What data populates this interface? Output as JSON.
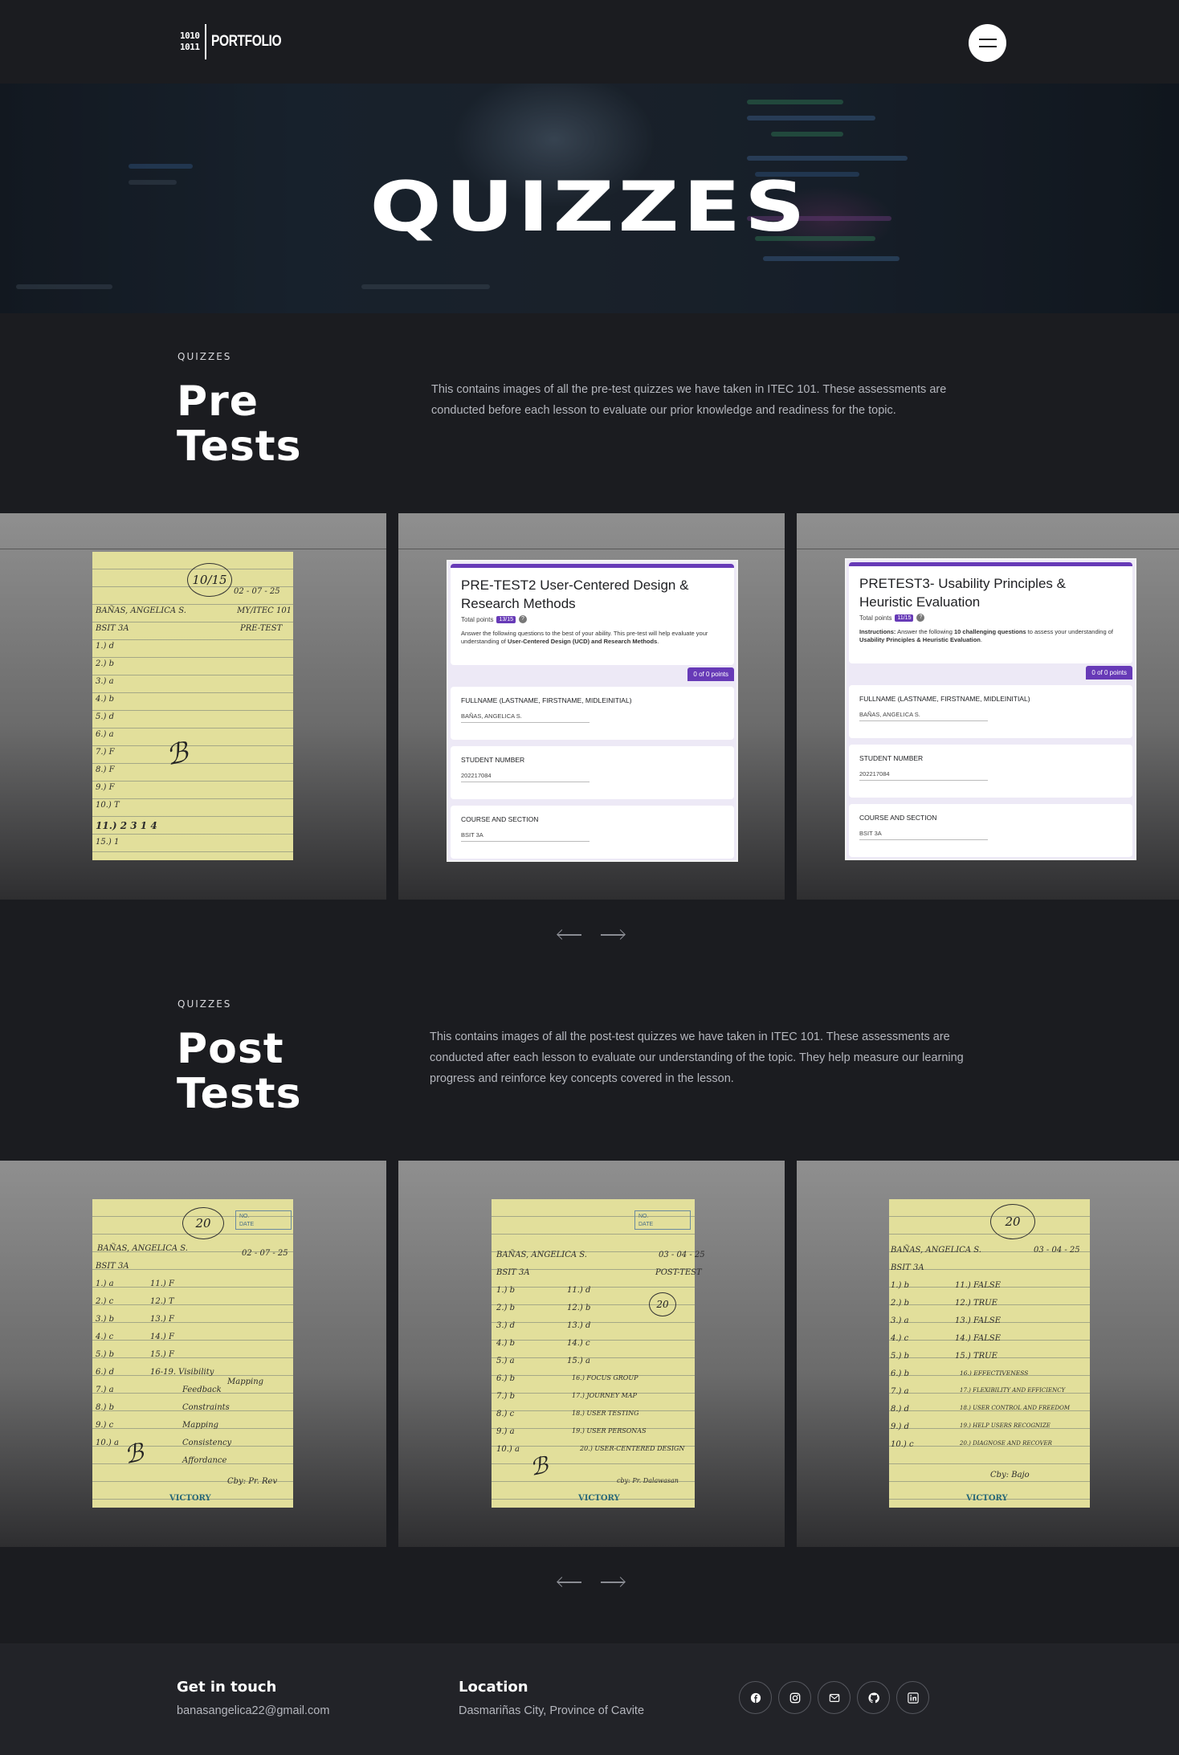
{
  "header": {
    "logo_bits_1": "1010",
    "logo_bits_2": "1011",
    "logo_word": "PORTFOLIO",
    "menu_icon": "hamburger-icon"
  },
  "hero": {
    "title": "QUIZZES"
  },
  "pretests": {
    "eyebrow": "QUIZZES",
    "title_line1": "Pre",
    "title_line2": "Tests",
    "description": "This contains images of all the pre-test quizzes we have taken in ITEC 101. These assessments are conducted before each lesson to evaluate our prior knowledge and readiness for the topic.",
    "slide1": {
      "score": "10/15",
      "name": "BAÑAS, ANGELICA S.",
      "section": "BSIT 3A",
      "date": "02 - 07 - 25",
      "course": "MY/ITEC 101",
      "type": "PRE-TEST",
      "answers": [
        "1.) d",
        "2.) b",
        "3.) a",
        "4.) b",
        "5.) d",
        "6.) a",
        "7.) F",
        "8.) F",
        "9.) F",
        "10.) T",
        "11.) 2 3 1 4",
        "15.) 1"
      ]
    },
    "slide2": {
      "title": "PRE-TEST2 User-Centered Design & Research Methods",
      "total_points_label": "Total points",
      "total_points": "13/15",
      "instructions_a": "Answer the following questions to the best of your ability. This pre-test will help evaluate your understanding of ",
      "instructions_b": "User-Centered Design (UCD) and Research Methods",
      "instructions_c": ".",
      "points_tag": "0 of 0 points",
      "fields": [
        {
          "label": "FULLNAME (LASTNAME, FIRSTNAME, MIDLEINITIAL)",
          "value": "BAÑAS, ANGELICA S."
        },
        {
          "label": "STUDENT NUMBER",
          "value": "202217084"
        },
        {
          "label": "COURSE AND SECTION",
          "value": "BSIT 3A"
        }
      ]
    },
    "slide3": {
      "title": "PRETEST3- Usability Principles & Heuristic Evaluation",
      "total_points_label": "Total points",
      "total_points": "11/15",
      "instructions_prefix": "Instructions:",
      "instructions_a": " Answer the following ",
      "instructions_b": "10 challenging questions",
      "instructions_c": " to assess your understanding of ",
      "instructions_d": "Usability Principles & Heuristic Evaluation",
      "instructions_e": ".",
      "points_tag": "0 of 0 points",
      "fields": [
        {
          "label": "FULLNAME (LASTNAME, FIRSTNAME, MIDLEINITIAL)",
          "value": "BAÑAS, ANGELICA S."
        },
        {
          "label": "STUDENT NUMBER",
          "value": "202217084"
        },
        {
          "label": "COURSE AND SECTION",
          "value": "BSIT 3A"
        }
      ]
    }
  },
  "posttests": {
    "eyebrow": "QUIZZES",
    "title_line1": "Post",
    "title_line2": "Tests",
    "description": "This contains images of all the post-test quizzes we have taken in ITEC 101. These assessments are conducted after each lesson to evaluate our understanding of the topic. They help measure our learning progress and reinforce key concepts covered in the lesson.",
    "slide1": {
      "score": "20",
      "no_label": "NO.",
      "date_label": "DATE",
      "name": "BAÑAS, ANGELICA S.",
      "date": "02 - 07 - 25",
      "section": "BSIT 3A",
      "answers_left": [
        "1.) a",
        "2.) c",
        "3.) b",
        "4.) c",
        "5.) b",
        "6.) d",
        "7.) a",
        "8.) b",
        "9.) c",
        "10.) a"
      ],
      "answers_right": [
        "11.) F",
        "12.) T",
        "13.) F",
        "14.) F",
        "15.) F",
        "16-19. Visibility",
        "Feedback",
        "Constraints",
        "Mapping",
        "Consistency",
        "Affordance"
      ],
      "side_note": "Mapping",
      "signature_note": "Cby: Pr. Rev",
      "brand": "VICTORY"
    },
    "slide2": {
      "score": "20",
      "no_label": "NO.",
      "date_label": "DATE",
      "name": "BAÑAS, ANGELICA S.",
      "date": "03 - 04 - 25",
      "section": "BSIT 3A",
      "type": "POST-TEST",
      "answers_left": [
        "1.) b",
        "2.) b",
        "3.) d",
        "4.) b",
        "5.) a",
        "6.) b",
        "7.) b",
        "8.) c",
        "9.) a",
        "10.) a"
      ],
      "answers_right": [
        "11.) d",
        "12.) b",
        "13.) d",
        "14.) c",
        "15.) a",
        "16.) FOCUS GROUP",
        "17.) JOURNEY MAP",
        "18.) USER TESTING",
        "19.) USER PERSONAS",
        "20.) USER-CENTERED DESIGN"
      ],
      "footer_note": "cby: Pr. Dalawasan",
      "brand": "VICTORY"
    },
    "slide3": {
      "score": "20",
      "name": "BAÑAS, ANGELICA S.",
      "date": "03 - 04 - 25",
      "section": "BSIT 3A",
      "answers_left": [
        "1.) b",
        "2.) b",
        "3.) a",
        "4.) c",
        "5.) b",
        "6.) b",
        "7.) a",
        "8.) d",
        "9.) d",
        "10.) c"
      ],
      "answers_right": [
        "11.) FALSE",
        "12.) TRUE",
        "13.) FALSE",
        "14.) FALSE",
        "15.) TRUE",
        "16.) EFFECTIVENESS",
        "17.) FLEXIBILITY AND EFFICIENCY",
        "18.) USER CONTROL AND FREEDOM",
        "19.) HELP USERS RECOGNIZE",
        "20.) DIAGNOSE AND RECOVER"
      ],
      "signature_note": "Cby: Bajo",
      "brand": "VICTORY"
    }
  },
  "footer": {
    "contact_heading": "Get in touch",
    "email": "banasangelica22@gmail.com",
    "location_heading": "Location",
    "location": "Dasmariñas City, Province of Cavite",
    "social_icons": [
      "facebook-icon",
      "instagram-icon",
      "mail-icon",
      "github-icon",
      "linkedin-icon"
    ]
  }
}
